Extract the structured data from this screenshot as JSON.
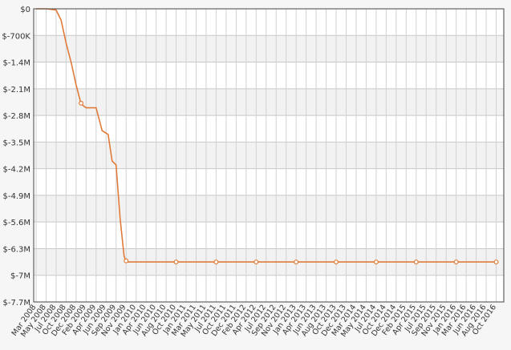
{
  "chart_data": {
    "type": "line",
    "title": "",
    "xlabel": "",
    "ylabel": "",
    "ylim": [
      -7700000,
      0
    ],
    "y_ticks": [
      0,
      -700000,
      -1400000,
      -2100000,
      -2800000,
      -3500000,
      -4200000,
      -4900000,
      -5600000,
      -6300000,
      -7000000,
      -7700000
    ],
    "y_tick_labels": [
      "$0",
      "$-700K",
      "$-1.4M",
      "$-2.1M",
      "$-2.8M",
      "$-3.5M",
      "$-4.2M",
      "$-4.9M",
      "$-5.6M",
      "$-6.3M",
      "$-7M",
      "$-7.7M"
    ],
    "x_tick_labels": [
      "Mar 2008",
      "May 2008",
      "Jul 2008",
      "Oct 2008",
      "Dec 2008",
      "Feb 2009",
      "Apr 2009",
      "Jun 2009",
      "Sep 2009",
      "Nov 2009",
      "Jan 2010",
      "Apr 2010",
      "Jun 2010",
      "Aug 2010",
      "Oct 2010",
      "Jan 2011",
      "Mar 2011",
      "May 2011",
      "Jul 2011",
      "Oct 2011",
      "Dec 2011",
      "Feb 2012",
      "Apr 2012",
      "Jul 2012",
      "Sep 2012",
      "Nov 2012",
      "Jan 2013",
      "Apr 2013",
      "Jun 2013",
      "Aug 2013",
      "Oct 2013",
      "Dec 2013",
      "Mar 2014",
      "May 2014",
      "Jul 2014",
      "Oct 2014",
      "Dec 2014",
      "Feb 2015",
      "Apr 2015",
      "Jul 2015",
      "Sep 2015",
      "Nov 2015",
      "Jan 2016",
      "Mar 2016",
      "Jun 2016",
      "Aug 2016",
      "Oct 2016"
    ],
    "grid": true,
    "line_color": "#e07b39",
    "series": [
      {
        "points": [
          [
            0,
            0
          ],
          [
            1,
            0
          ],
          [
            2,
            -30000
          ],
          [
            2.5,
            -300000
          ],
          [
            3,
            -900000
          ],
          [
            3.5,
            -1400000
          ],
          [
            4,
            -2000000
          ],
          [
            4.5,
            -2500000
          ],
          [
            5,
            -2600000
          ],
          [
            6,
            -2600000
          ],
          [
            6.6,
            -3200000
          ],
          [
            7.2,
            -3300000
          ],
          [
            7.6,
            -4000000
          ],
          [
            8,
            -4100000
          ],
          [
            8.4,
            -5500000
          ],
          [
            8.8,
            -6500000
          ],
          [
            9,
            -6650000
          ],
          [
            10,
            -6650000
          ],
          [
            12,
            -6650000
          ],
          [
            14,
            -6650000
          ],
          [
            16,
            -6650000
          ],
          [
            18,
            -6650000
          ],
          [
            20,
            -6650000
          ],
          [
            22,
            -6650000
          ],
          [
            24,
            -6650000
          ],
          [
            26,
            -6650000
          ],
          [
            28,
            -6650000
          ],
          [
            30,
            -6650000
          ],
          [
            32,
            -6650000
          ],
          [
            34,
            -6650000
          ],
          [
            36,
            -6650000
          ],
          [
            38,
            -6650000
          ],
          [
            40,
            -6650000
          ],
          [
            42,
            -6650000
          ],
          [
            44,
            -6650000
          ],
          [
            46,
            -6650000
          ]
        ]
      }
    ],
    "markers": [
      [
        4.5,
        -2480000
      ],
      [
        9,
        -6620000
      ],
      [
        14,
        -6650000
      ],
      [
        18,
        -6650000
      ],
      [
        22,
        -6650000
      ],
      [
        26,
        -6650000
      ],
      [
        30,
        -6650000
      ],
      [
        34,
        -6650000
      ],
      [
        38,
        -6650000
      ],
      [
        42,
        -6650000
      ],
      [
        46,
        -6650000
      ]
    ]
  }
}
